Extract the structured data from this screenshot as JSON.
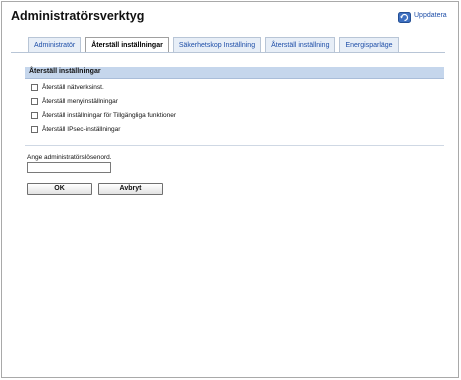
{
  "page": {
    "title": "Administratörsverktyg",
    "refresh_label": "Uppdatera"
  },
  "tabs": [
    {
      "label": "Administratör",
      "active": false
    },
    {
      "label": "Återställ inställningar",
      "active": true
    },
    {
      "label": "Säkerhetskop Inställning",
      "active": false
    },
    {
      "label": "Återställ inställning",
      "active": false
    },
    {
      "label": "Energisparläge",
      "active": false
    }
  ],
  "section": {
    "title": "Återställ inställningar",
    "options": [
      {
        "label": "Återställ nätverksinst.",
        "checked": false
      },
      {
        "label": "Återställ menyinställningar",
        "checked": false
      },
      {
        "label": "Återställ inställningar för Tillgängliga funktioner",
        "checked": false
      },
      {
        "label": "Återställ IPsec-inställningar",
        "checked": false
      }
    ]
  },
  "password": {
    "label": "Ange administratörslösenord.",
    "value": ""
  },
  "buttons": {
    "ok": "OK",
    "cancel": "Avbryt"
  },
  "colors": {
    "section_bar": "#c5d6ec",
    "tab_bg": "#e7eef7",
    "link": "#1f4fa8"
  },
  "icons": {
    "refresh": "refresh-icon"
  }
}
